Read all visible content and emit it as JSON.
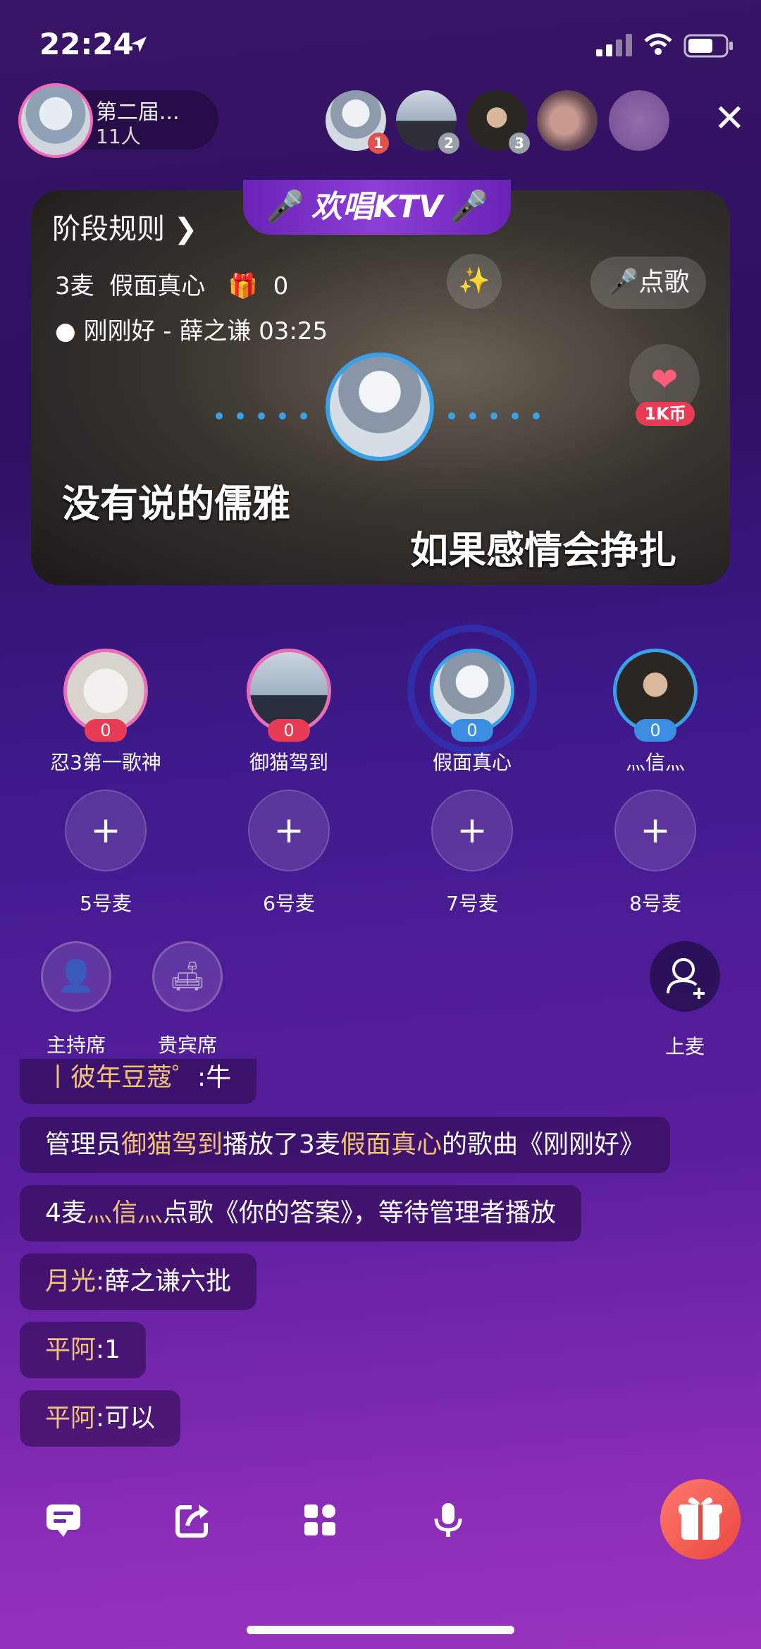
{
  "status": {
    "time": "22:24"
  },
  "room": {
    "title": "第二届...",
    "count": "11人"
  },
  "viewers": [
    {
      "rank": "1",
      "color": "#e35050"
    },
    {
      "rank": "2",
      "color": "#9aa0aa"
    },
    {
      "rank": "3",
      "color": "#9aa0aa"
    }
  ],
  "ktv": {
    "tab_label": "欢唱KTV",
    "rules_label": "阶段规则",
    "mic": "3麦",
    "singer": "假面真心",
    "gift_count": "0",
    "song": "刚刚好 - 薛之谦 03:25",
    "request_label": "点歌",
    "coin_label": "1K币",
    "lyric_line1": "没有说的儒雅",
    "lyric_line2": "如果感情会挣扎"
  },
  "seats": [
    {
      "name": "忍3第一歌神",
      "count": "0",
      "ring": "#e870b8",
      "badge": "#e83b55"
    },
    {
      "name": "御猫驾到",
      "count": "0",
      "ring": "#e870b8",
      "badge": "#e83b55"
    },
    {
      "name": "假面真心",
      "count": "0",
      "ring": "#3aa0e8",
      "badge": "#3a8de0"
    },
    {
      "name": "灬信灬",
      "count": "0",
      "ring": "#3aa0e8",
      "badge": "#3a8de0"
    }
  ],
  "empty_seats": [
    "5号麦",
    "6号麦",
    "7号麦",
    "8号麦"
  ],
  "roles": {
    "host": "主持席",
    "vip": "贵宾席",
    "join": "上麦"
  },
  "chat": {
    "partial": {
      "name": "丨彼年豆蔻゜",
      "text": ":牛"
    },
    "msg1": {
      "a": "管理员",
      "b": "御猫驾到",
      "c": "播放了3麦",
      "d": "假面真心",
      "e": "的歌曲《刚刚好》"
    },
    "msg2": {
      "a": "4麦",
      "b": "灬信灬",
      "c": "点歌《你的答案》，等待管理者播放"
    },
    "msg3": {
      "a": "月光",
      "b": ":薛之谦六批"
    },
    "msg4": {
      "a": "平阿",
      "b": ":1"
    },
    "msg5": {
      "a": "平阿",
      "b": ":可以"
    }
  },
  "icons": {
    "chat": "chat-icon",
    "share": "share-icon",
    "apps": "apps-icon",
    "mic": "microphone-icon",
    "gift": "gift-icon"
  },
  "accent": "#f1c27a"
}
